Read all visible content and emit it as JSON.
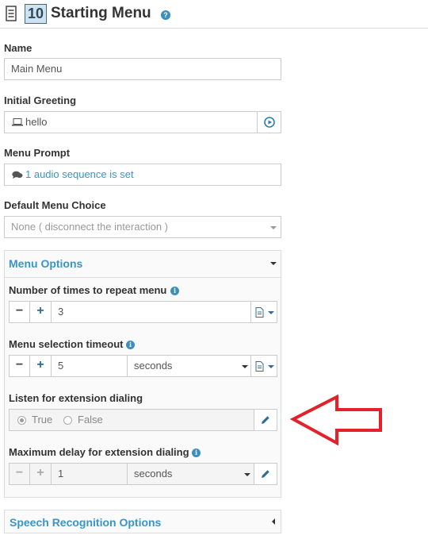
{
  "header": {
    "number": "10",
    "title": "Starting Menu",
    "help_icon": "question-circle-icon"
  },
  "name": {
    "label": "Name",
    "value": "Main Menu"
  },
  "initial_greeting": {
    "label": "Initial Greeting",
    "value": "hello",
    "icon": "laptop-icon",
    "play_icon": "play-circle-icon"
  },
  "menu_prompt": {
    "label": "Menu Prompt",
    "value": "1 audio sequence is set",
    "icon": "comments-icon"
  },
  "default_choice": {
    "label": "Default Menu Choice",
    "value": "None ( disconnect the interaction )"
  },
  "menu_options": {
    "title": "Menu Options",
    "repeat": {
      "label": "Number of times to repeat menu",
      "value": "3",
      "minus": "−",
      "plus": "+"
    },
    "timeout": {
      "label": "Menu selection timeout",
      "value": "5",
      "unit": "seconds",
      "minus": "−",
      "plus": "+"
    },
    "extension": {
      "label": "Listen for extension dialing",
      "option_true": "True",
      "option_false": "False",
      "selected": "True"
    },
    "max_delay": {
      "label": "Maximum delay for extension dialing",
      "value": "1",
      "unit": "seconds",
      "minus": "−",
      "plus": "+"
    }
  },
  "speech": {
    "title": "Speech Recognition Options"
  },
  "annotation": {
    "color": "#e3212a",
    "icon": "left-arrow-outline"
  },
  "colors": {
    "accent": "#3a95c4",
    "badge_bg": "#cfe2ef"
  }
}
